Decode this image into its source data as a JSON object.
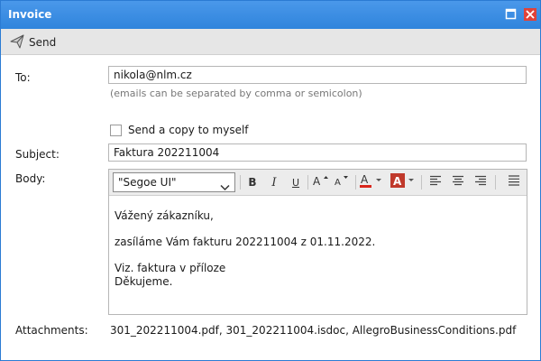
{
  "window": {
    "title": "Invoice"
  },
  "toolbar": {
    "send_label": "Send"
  },
  "form": {
    "to_label": "To:",
    "to_value": "nikola@nlm.cz",
    "to_hint": "(emails can be separated by comma or semicolon)",
    "copy_label": "Send a copy to myself",
    "copy_checked": false,
    "subject_label": "Subject:",
    "subject_value": "Faktura 202211004",
    "body_label": "Body:",
    "attachments_label": "Attachments:",
    "attachments_value": "301_202211004.pdf, 301_202211004.isdoc, AllegroBusinessConditions.pdf"
  },
  "editor": {
    "font": "\"Segoe UI\"",
    "bold": "B",
    "italic": "I",
    "underline": "U",
    "lines": [
      "Vážený zákazníku,",
      "zasíláme Vám fakturu 202211004 z 01.11.2022.",
      "Viz. faktura v příloze",
      "Děkujeme."
    ]
  },
  "colors": {
    "titlebar": "#3a8ee6",
    "font_color_underline": "#d9261c",
    "highlight_bg": "#c0392b"
  },
  "icons": [
    "maximize-icon",
    "close-icon",
    "send-icon",
    "chevron-down-icon",
    "font-size-increase-icon",
    "font-size-decrease-icon",
    "font-color-icon",
    "highlight-color-icon",
    "align-left-icon",
    "align-center-icon",
    "align-right-icon",
    "more-options-icon"
  ]
}
